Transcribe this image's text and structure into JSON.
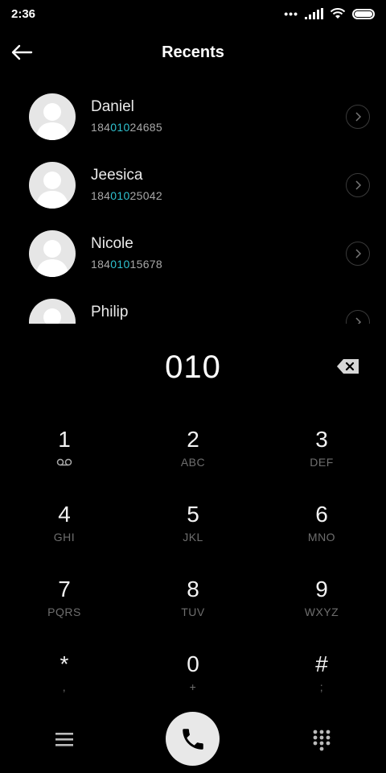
{
  "status_bar": {
    "time": "2:36",
    "dots": "•••"
  },
  "header": {
    "title": "Recents"
  },
  "recents": [
    {
      "name": "Daniel",
      "number_prefix": "184",
      "number_match": "010",
      "number_suffix": "24685"
    },
    {
      "name": "Jeesica",
      "number_prefix": "184",
      "number_match": "010",
      "number_suffix": "25042"
    },
    {
      "name": "Nicole",
      "number_prefix": "184",
      "number_match": "010",
      "number_suffix": "15678"
    },
    {
      "name": "Philip",
      "number_prefix": "",
      "number_match": "",
      "number_suffix": ""
    }
  ],
  "dialer": {
    "number": "010"
  },
  "keypad": [
    {
      "digit": "1",
      "letters": ""
    },
    {
      "digit": "2",
      "letters": "ABC"
    },
    {
      "digit": "3",
      "letters": "DEF"
    },
    {
      "digit": "4",
      "letters": "GHI"
    },
    {
      "digit": "5",
      "letters": "JKL"
    },
    {
      "digit": "6",
      "letters": "MNO"
    },
    {
      "digit": "7",
      "letters": "PQRS"
    },
    {
      "digit": "8",
      "letters": "TUV"
    },
    {
      "digit": "9",
      "letters": "WXYZ"
    },
    {
      "digit": "*",
      "letters": ","
    },
    {
      "digit": "0",
      "letters": "+"
    },
    {
      "digit": "#",
      "letters": ";"
    }
  ],
  "icons": {
    "back": "arrow-left-icon",
    "backspace": "backspace-icon",
    "voicemail": "voicemail-icon",
    "menu": "menu-icon",
    "call": "phone-icon",
    "dialpad": "dialpad-icon"
  },
  "colors": {
    "accent": "#2fc2d0",
    "background": "#000000",
    "call_button": "#e8e8e8"
  }
}
